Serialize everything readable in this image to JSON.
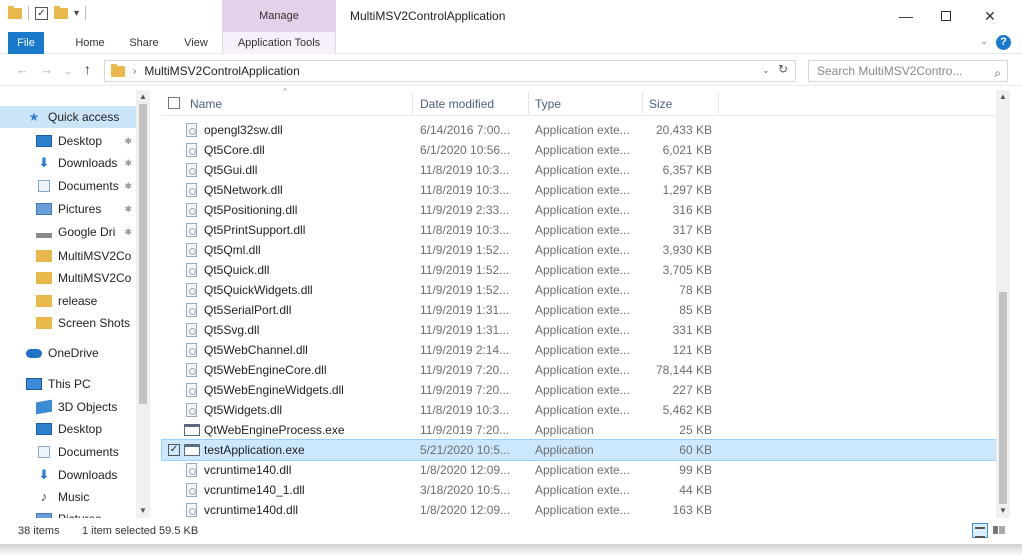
{
  "window": {
    "title": "MultiMSV2ControlApplication",
    "context_tab_group": "Manage",
    "minimize": "—",
    "close": "✕"
  },
  "ribbon": {
    "tabs": [
      "File",
      "Home",
      "Share",
      "View",
      "Application Tools"
    ]
  },
  "address": {
    "path": "MultiMSV2ControlApplication",
    "search_placeholder": "Search MultiMSV2Contro..."
  },
  "nav_pane": {
    "items": [
      {
        "label": "Quick access",
        "icon": "star-icon",
        "selected": true,
        "pinned": false
      },
      {
        "label": "Desktop",
        "icon": "desktop-icon",
        "pinned": true
      },
      {
        "label": "Downloads",
        "icon": "downloads-icon",
        "pinned": true
      },
      {
        "label": "Documents",
        "icon": "documents-icon",
        "pinned": true
      },
      {
        "label": "Pictures",
        "icon": "pictures-icon",
        "pinned": true
      },
      {
        "label": "Google Dri",
        "icon": "drive-icon",
        "pinned": true
      },
      {
        "label": "MultiMSV2Co",
        "icon": "folder-icon",
        "pinned": false
      },
      {
        "label": "MultiMSV2Co",
        "icon": "folder-icon",
        "pinned": false
      },
      {
        "label": "release",
        "icon": "folder-icon",
        "pinned": false
      },
      {
        "label": "Screen Shots",
        "icon": "folder-icon",
        "pinned": false
      },
      {
        "label": "OneDrive",
        "icon": "onedrive-icon",
        "pinned": false
      },
      {
        "label": "This PC",
        "icon": "pc-icon",
        "pinned": false
      },
      {
        "label": "3D Objects",
        "icon": "3d-objects-icon",
        "pinned": false
      },
      {
        "label": "Desktop",
        "icon": "desktop-icon",
        "pinned": false
      },
      {
        "label": "Documents",
        "icon": "documents-icon",
        "pinned": false
      },
      {
        "label": "Downloads",
        "icon": "downloads-icon",
        "pinned": false
      },
      {
        "label": "Music",
        "icon": "music-icon",
        "pinned": false
      },
      {
        "label": "Pictures",
        "icon": "pictures-icon",
        "pinned": false
      }
    ]
  },
  "file_list": {
    "columns": {
      "name": "Name",
      "date": "Date modified",
      "type": "Type",
      "size": "Size"
    },
    "rows": [
      {
        "name": "opengl32sw.dll",
        "date": "6/14/2016 7:00...",
        "type": "Application exte...",
        "size": "20,433 KB",
        "kind": "dll"
      },
      {
        "name": "Qt5Core.dll",
        "date": "6/1/2020 10:56...",
        "type": "Application exte...",
        "size": "6,021 KB",
        "kind": "dll"
      },
      {
        "name": "Qt5Gui.dll",
        "date": "11/8/2019 10:3...",
        "type": "Application exte...",
        "size": "6,357 KB",
        "kind": "dll"
      },
      {
        "name": "Qt5Network.dll",
        "date": "11/8/2019 10:3...",
        "type": "Application exte...",
        "size": "1,297 KB",
        "kind": "dll"
      },
      {
        "name": "Qt5Positioning.dll",
        "date": "11/9/2019 2:33...",
        "type": "Application exte...",
        "size": "316 KB",
        "kind": "dll"
      },
      {
        "name": "Qt5PrintSupport.dll",
        "date": "11/8/2019 10:3...",
        "type": "Application exte...",
        "size": "317 KB",
        "kind": "dll"
      },
      {
        "name": "Qt5Qml.dll",
        "date": "11/9/2019 1:52...",
        "type": "Application exte...",
        "size": "3,930 KB",
        "kind": "dll"
      },
      {
        "name": "Qt5Quick.dll",
        "date": "11/9/2019 1:52...",
        "type": "Application exte...",
        "size": "3,705 KB",
        "kind": "dll"
      },
      {
        "name": "Qt5QuickWidgets.dll",
        "date": "11/9/2019 1:52...",
        "type": "Application exte...",
        "size": "78 KB",
        "kind": "dll"
      },
      {
        "name": "Qt5SerialPort.dll",
        "date": "11/9/2019 1:31...",
        "type": "Application exte...",
        "size": "85 KB",
        "kind": "dll"
      },
      {
        "name": "Qt5Svg.dll",
        "date": "11/9/2019 1:31...",
        "type": "Application exte...",
        "size": "331 KB",
        "kind": "dll"
      },
      {
        "name": "Qt5WebChannel.dll",
        "date": "11/9/2019 2:14...",
        "type": "Application exte...",
        "size": "121 KB",
        "kind": "dll"
      },
      {
        "name": "Qt5WebEngineCore.dll",
        "date": "11/9/2019 7:20...",
        "type": "Application exte...",
        "size": "78,144 KB",
        "kind": "dll"
      },
      {
        "name": "Qt5WebEngineWidgets.dll",
        "date": "11/9/2019 7:20...",
        "type": "Application exte...",
        "size": "227 KB",
        "kind": "dll"
      },
      {
        "name": "Qt5Widgets.dll",
        "date": "11/8/2019 10:3...",
        "type": "Application exte...",
        "size": "5,462 KB",
        "kind": "dll"
      },
      {
        "name": "QtWebEngineProcess.exe",
        "date": "11/9/2019 7:20...",
        "type": "Application",
        "size": "25 KB",
        "kind": "exe"
      },
      {
        "name": "testApplication.exe",
        "date": "5/21/2020 10:5...",
        "type": "Application",
        "size": "60 KB",
        "kind": "exe",
        "selected": true
      },
      {
        "name": "vcruntime140.dll",
        "date": "1/8/2020 12:09...",
        "type": "Application exte...",
        "size": "99 KB",
        "kind": "dll"
      },
      {
        "name": "vcruntime140_1.dll",
        "date": "3/18/2020 10:5...",
        "type": "Application exte...",
        "size": "44 KB",
        "kind": "dll"
      },
      {
        "name": "vcruntime140d.dll",
        "date": "1/8/2020 12:09...",
        "type": "Application exte...",
        "size": "163 KB",
        "kind": "dll"
      }
    ]
  },
  "status": {
    "item_count": "38 items",
    "selection": "1 item selected  59.5 KB"
  },
  "colors": {
    "accent": "#1979ca",
    "manage_tab": "#e4d0ea",
    "selection": "#cce8ff",
    "nav_selected": "#cce4f7"
  }
}
